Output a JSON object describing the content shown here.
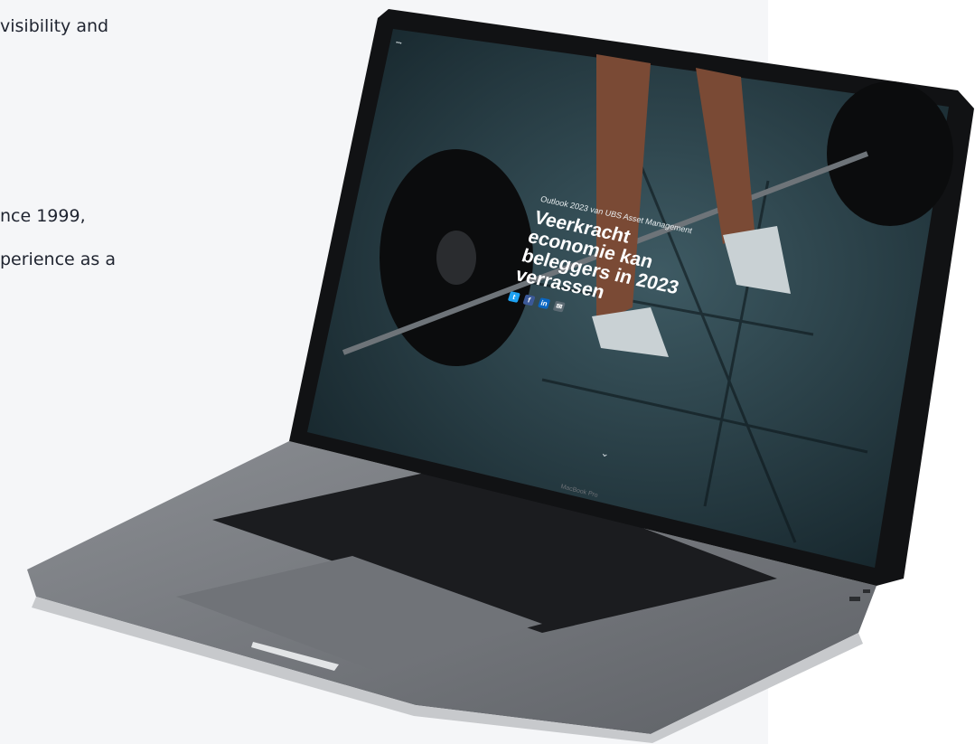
{
  "intro": {
    "line1": "visibility and",
    "line2": "nce 1999,",
    "line3": "perience as a"
  },
  "article": {
    "kicker": "Outlook 2023 van UBS Asset Management",
    "headline_lines": [
      "Veerkracht",
      "economie kan",
      "beleggers in 2023",
      "verrassen"
    ],
    "share_icons": [
      "twitter-icon",
      "facebook-icon",
      "linkedin-icon",
      "mail-icon"
    ],
    "scroll_glyph": "⌄"
  },
  "device": {
    "brand_label": "MacBook Pro"
  },
  "colors": {
    "page_bg": "#f5f6f8",
    "text": "#1f2430",
    "twitter": "#1da1f2",
    "facebook": "#3b5998",
    "linkedin": "#0a66c2"
  }
}
